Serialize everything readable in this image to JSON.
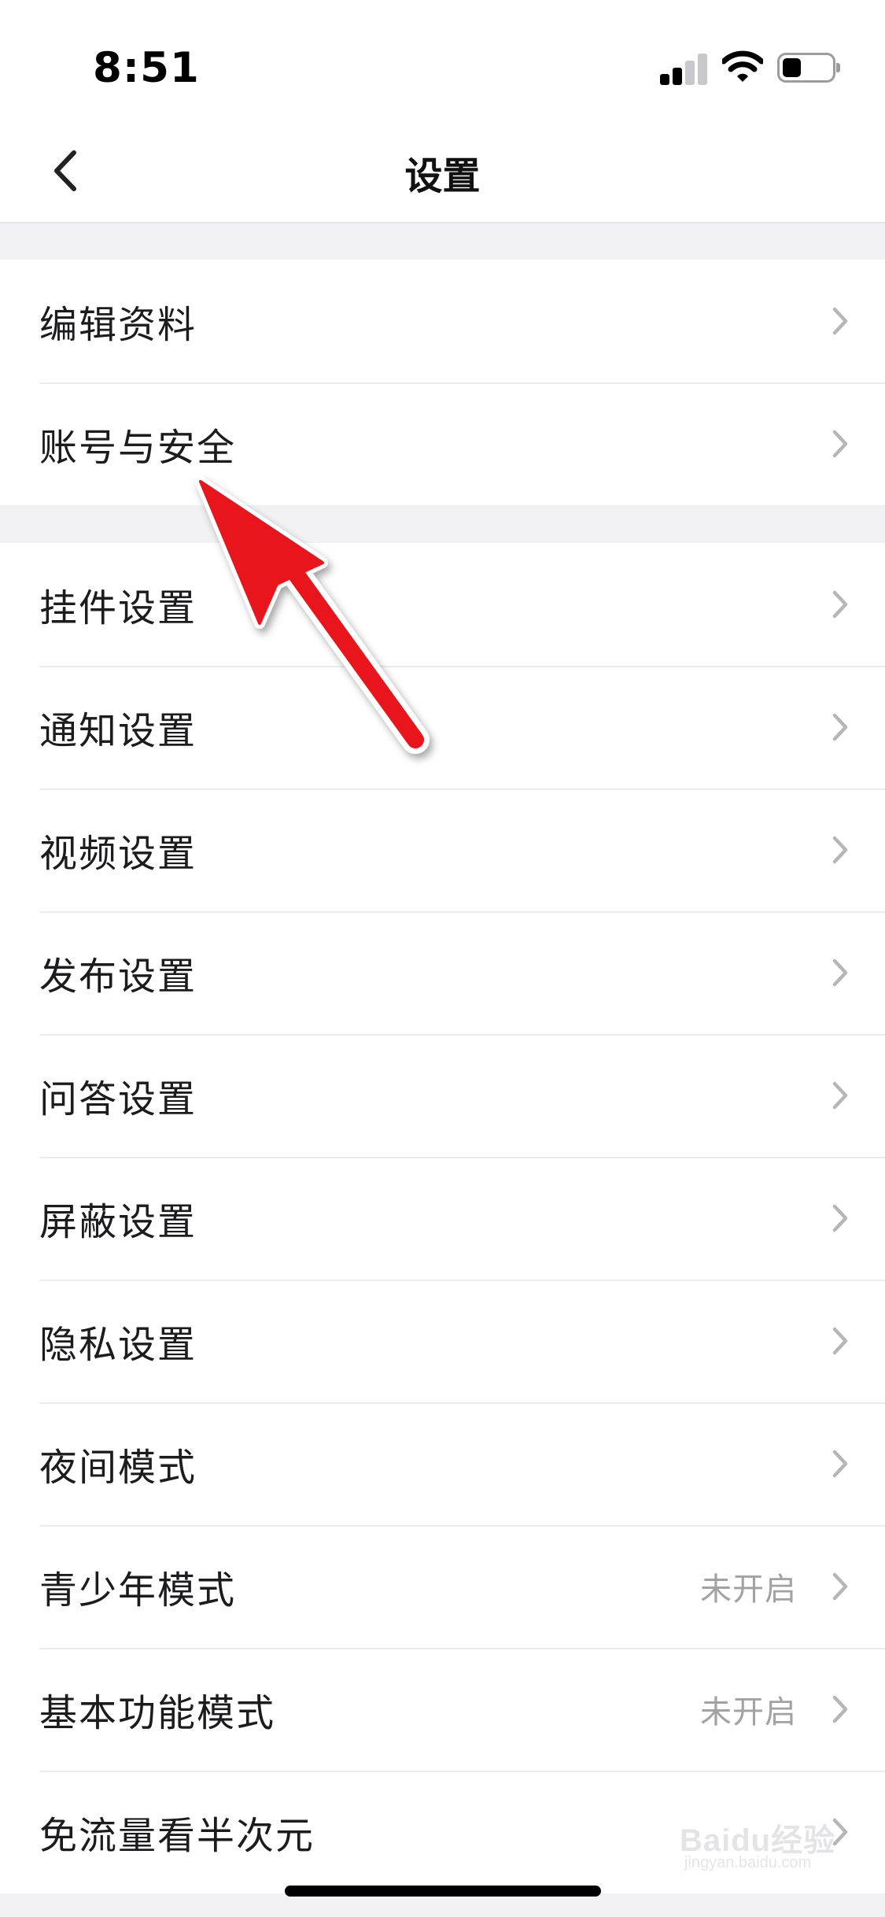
{
  "status_bar": {
    "time": "8:51",
    "battery_level": 0.4
  },
  "nav": {
    "title": "设置",
    "back_icon": "chevron-left-icon"
  },
  "groups": [
    {
      "items": [
        {
          "label": "编辑资料",
          "status": ""
        },
        {
          "label": "账号与安全",
          "status": ""
        }
      ]
    },
    {
      "items": [
        {
          "label": "挂件设置",
          "status": ""
        },
        {
          "label": "通知设置",
          "status": ""
        },
        {
          "label": "视频设置",
          "status": ""
        },
        {
          "label": "发布设置",
          "status": ""
        },
        {
          "label": "问答设置",
          "status": ""
        },
        {
          "label": "屏蔽设置",
          "status": ""
        },
        {
          "label": "隐私设置",
          "status": ""
        },
        {
          "label": "夜间模式",
          "status": ""
        },
        {
          "label": "青少年模式",
          "status": "未开启"
        },
        {
          "label": "基本功能模式",
          "status": "未开启"
        },
        {
          "label": "免流量看半次元",
          "status": ""
        }
      ]
    }
  ],
  "watermark": {
    "logo_text": "Baidu经验",
    "sub_text": "jingyan.baidu.com"
  },
  "colors": {
    "background": "#f2f2f5",
    "row_background": "#ffffff",
    "secondary_text": "#a1a1a6",
    "annotation_arrow": "#e8141c"
  }
}
